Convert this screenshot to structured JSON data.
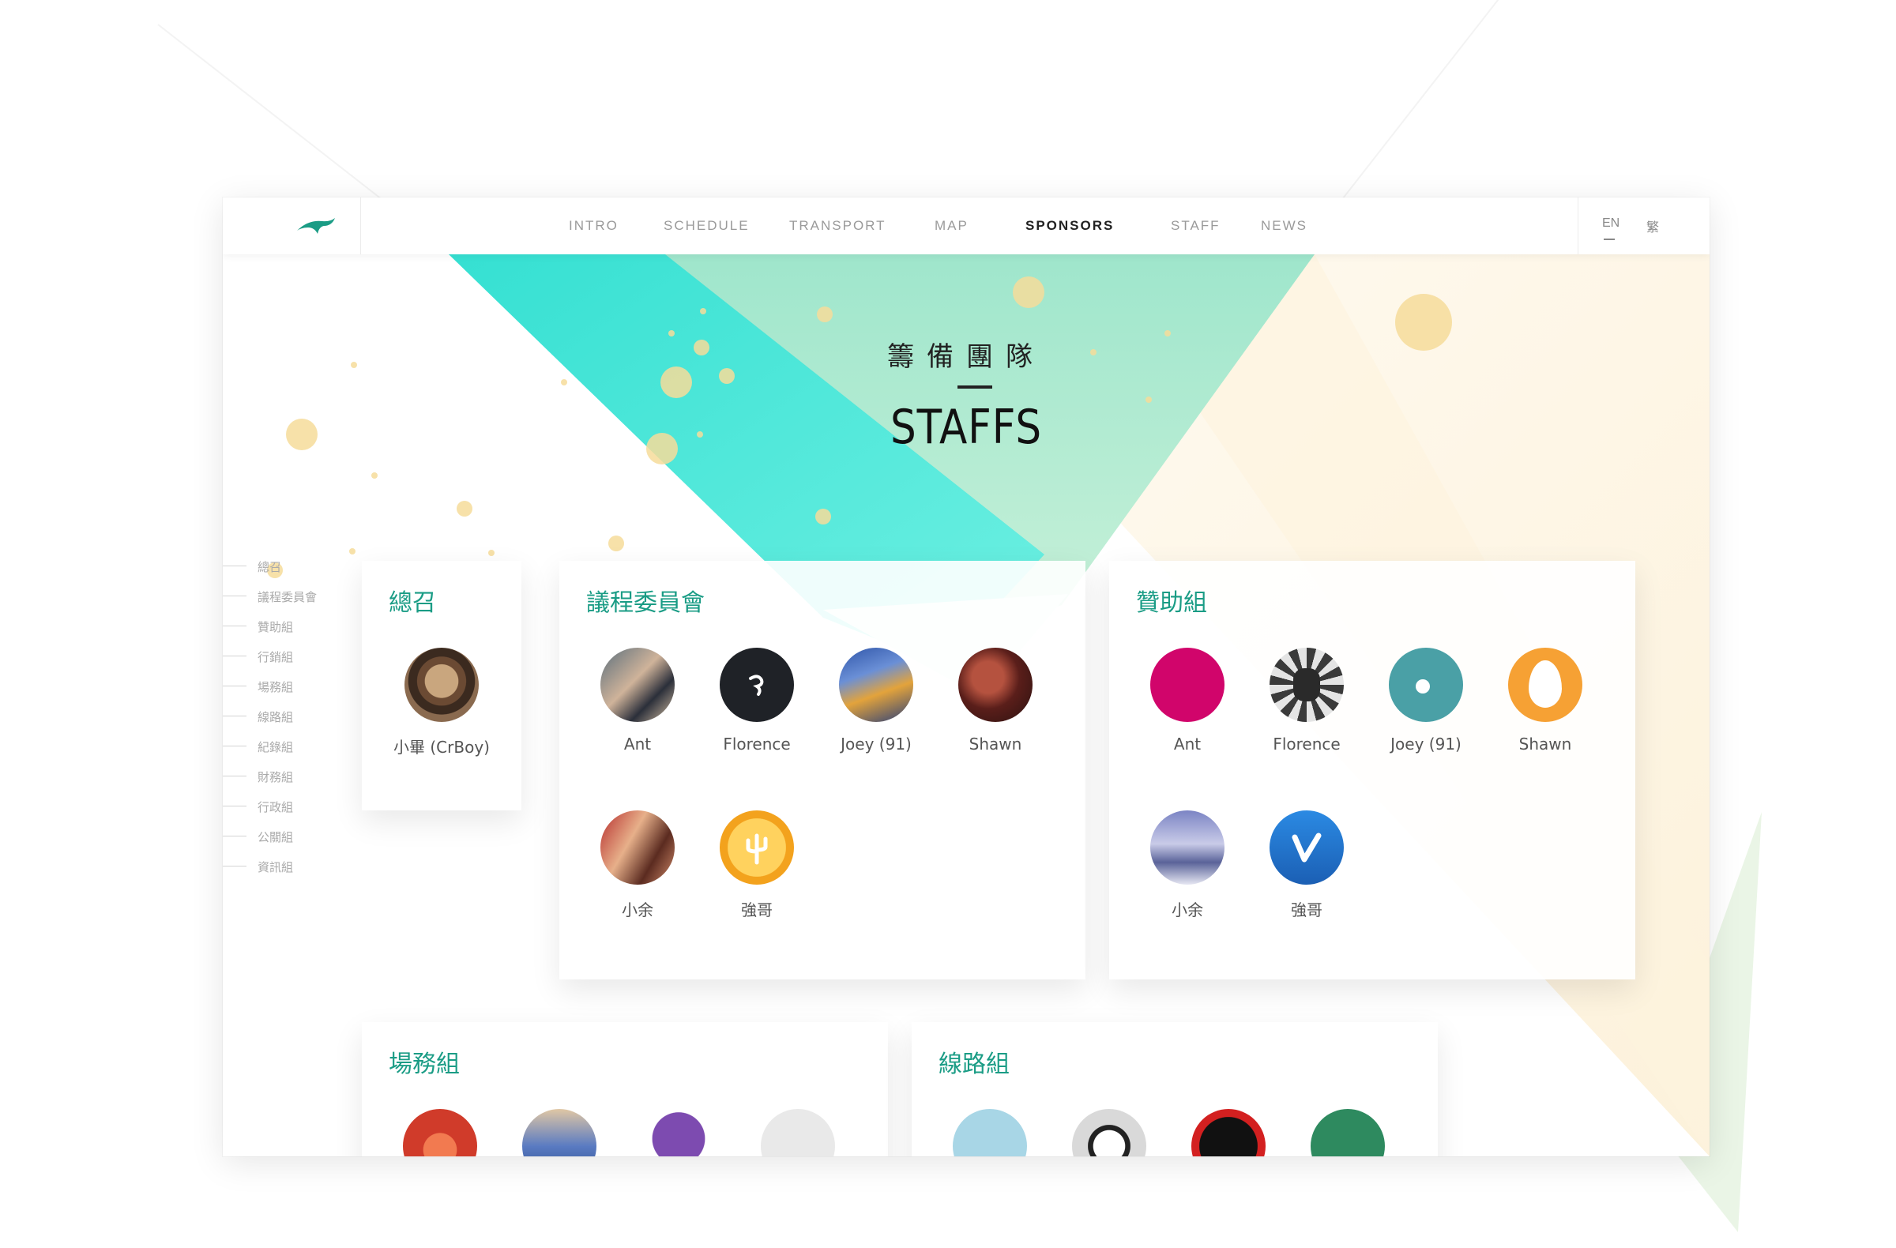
{
  "nav": {
    "items": [
      "INTRO",
      "SCHEDULE",
      "TRANSPORT",
      "MAP",
      "SPONSORS",
      "STAFF",
      "NEWS"
    ],
    "active": "SPONSORS",
    "lang": [
      "EN",
      "繁"
    ]
  },
  "hero": {
    "subtitle": "籌備團隊",
    "title": "STAFFS"
  },
  "sidebar": [
    "總召",
    "議程委員會",
    "贊助組",
    "行銷組",
    "場務組",
    "線路組",
    "紀錄組",
    "財務組",
    "行政組",
    "公關組",
    "資訊組"
  ],
  "teams": [
    {
      "title": "總召",
      "members": [
        {
          "name": "小畢 (CrBoy)"
        }
      ]
    },
    {
      "title": "議程委員會",
      "members": [
        {
          "name": "Ant"
        },
        {
          "name": "Florence"
        },
        {
          "name": "Joey (91)"
        },
        {
          "name": "Shawn"
        },
        {
          "name": "小余"
        },
        {
          "name": "強哥"
        }
      ]
    },
    {
      "title": "贊助組",
      "members": [
        {
          "name": "Ant"
        },
        {
          "name": "Florence"
        },
        {
          "name": "Joey (91)"
        },
        {
          "name": "Shawn"
        },
        {
          "name": "小余"
        },
        {
          "name": "強哥"
        }
      ]
    },
    {
      "title": "場務組",
      "members": []
    },
    {
      "title": "線路組",
      "members": []
    }
  ],
  "colors": {
    "accent": "#1a9c85",
    "teal": "#2fe0d0",
    "mint": "#a7e8c8",
    "dot": "#f6dc9a",
    "peach": "#fdf1d8"
  }
}
